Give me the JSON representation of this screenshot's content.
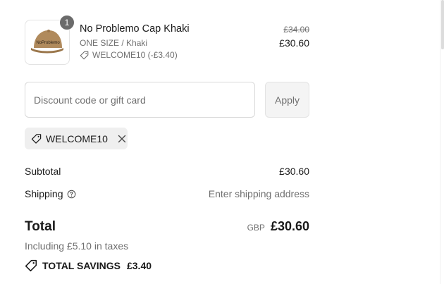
{
  "line_item": {
    "quantity": "1",
    "name": "No Problemo Cap Khaki",
    "variant": "ONE SIZE / Khaki",
    "discount": "WELCOME10 (-£3.40)",
    "original_price": "£34.00",
    "price": "£30.60",
    "thumbnail_logo_text": "NoProblemo"
  },
  "discount_form": {
    "placeholder": "Discount code or gift card",
    "apply_label": "Apply"
  },
  "applied_code": {
    "code": "WELCOME10"
  },
  "summary": {
    "subtotal_label": "Subtotal",
    "subtotal_value": "£30.60",
    "shipping_label": "Shipping",
    "shipping_value": "Enter shipping address",
    "total_label": "Total",
    "currency": "GBP",
    "total_value": "£30.60",
    "tax_note": "Including £5.10 in taxes",
    "savings_label": "TOTAL SAVINGS",
    "savings_value": "£3.40"
  },
  "icons": {
    "tag": "tag-icon",
    "close": "close-icon",
    "help": "help-circle-icon"
  },
  "colors": {
    "badge": "#6b6b6b",
    "muted_text": "#707070",
    "chip_bg": "#efefef",
    "cap_khaki": "#b08a5c"
  }
}
